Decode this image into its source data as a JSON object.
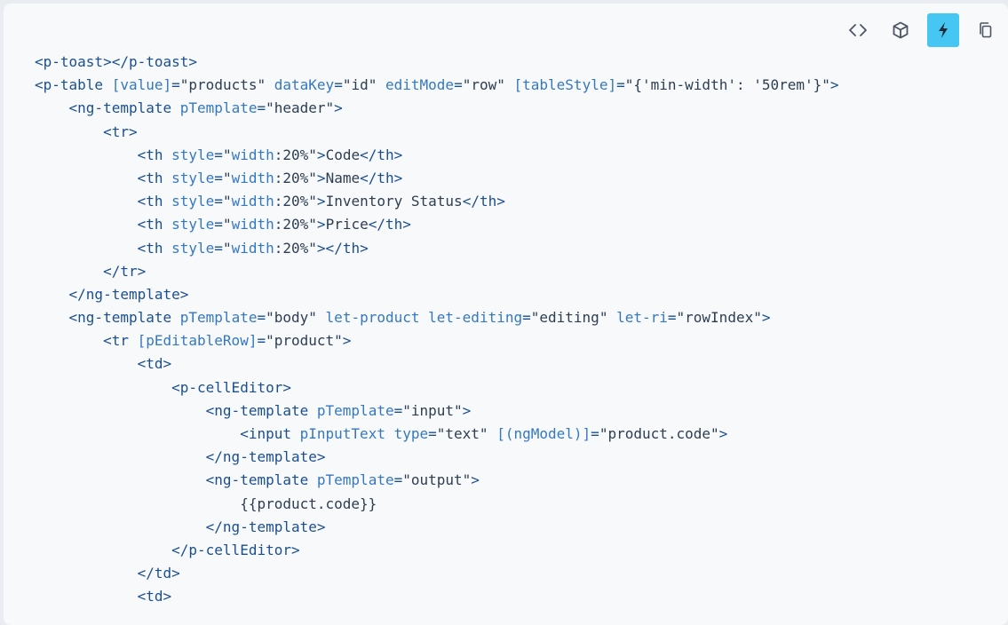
{
  "toolbar": {
    "buttons": [
      {
        "name": "code-toggle-button",
        "icon": "code-brackets-icon",
        "active": false
      },
      {
        "name": "stackblitz-box-button",
        "icon": "box-icon",
        "active": false
      },
      {
        "name": "stackblitz-button",
        "icon": "lightning-bolt-icon",
        "active": true
      },
      {
        "name": "copy-button",
        "icon": "copy-icon",
        "active": false
      }
    ],
    "active_color": "#45c6f3"
  },
  "code_lines": [
    {
      "indent": "",
      "parts": [
        [
          "tag",
          "<p-toast></p-toast>"
        ]
      ]
    },
    {
      "indent": "",
      "parts": [
        [
          "tag",
          "<p-table "
        ],
        [
          "attr",
          "[value]"
        ],
        [
          "tag",
          "="
        ],
        [
          "str",
          "\"products\" "
        ],
        [
          "attr",
          "dataKey"
        ],
        [
          "tag",
          "="
        ],
        [
          "str",
          "\"id\" "
        ],
        [
          "attr",
          "editMode"
        ],
        [
          "tag",
          "="
        ],
        [
          "str",
          "\"row\" "
        ],
        [
          "attr",
          "[tableStyle]"
        ],
        [
          "tag",
          "="
        ],
        [
          "str",
          "\"{'min-width': '50rem'}\""
        ],
        [
          "tag",
          ">"
        ]
      ]
    },
    {
      "indent": "    ",
      "parts": [
        [
          "tag",
          "<ng-template "
        ],
        [
          "attr",
          "pTemplate"
        ],
        [
          "tag",
          "="
        ],
        [
          "str",
          "\"header\""
        ],
        [
          "tag",
          ">"
        ]
      ]
    },
    {
      "indent": "        ",
      "parts": [
        [
          "tag",
          "<tr>"
        ]
      ]
    },
    {
      "indent": "            ",
      "parts": [
        [
          "tag",
          "<th "
        ],
        [
          "attr",
          "style"
        ],
        [
          "tag",
          "="
        ],
        [
          "str",
          "\""
        ],
        [
          "attr",
          "width"
        ],
        [
          "str",
          ":20%\""
        ],
        [
          "tag",
          ">"
        ],
        [
          "txt",
          "Code"
        ],
        [
          "tag",
          "</th>"
        ]
      ]
    },
    {
      "indent": "            ",
      "parts": [
        [
          "tag",
          "<th "
        ],
        [
          "attr",
          "style"
        ],
        [
          "tag",
          "="
        ],
        [
          "str",
          "\""
        ],
        [
          "attr",
          "width"
        ],
        [
          "str",
          ":20%\""
        ],
        [
          "tag",
          ">"
        ],
        [
          "txt",
          "Name"
        ],
        [
          "tag",
          "</th>"
        ]
      ]
    },
    {
      "indent": "            ",
      "parts": [
        [
          "tag",
          "<th "
        ],
        [
          "attr",
          "style"
        ],
        [
          "tag",
          "="
        ],
        [
          "str",
          "\""
        ],
        [
          "attr",
          "width"
        ],
        [
          "str",
          ":20%\""
        ],
        [
          "tag",
          ">"
        ],
        [
          "txt",
          "Inventory Status"
        ],
        [
          "tag",
          "</th>"
        ]
      ]
    },
    {
      "indent": "            ",
      "parts": [
        [
          "tag",
          "<th "
        ],
        [
          "attr",
          "style"
        ],
        [
          "tag",
          "="
        ],
        [
          "str",
          "\""
        ],
        [
          "attr",
          "width"
        ],
        [
          "str",
          ":20%\""
        ],
        [
          "tag",
          ">"
        ],
        [
          "txt",
          "Price"
        ],
        [
          "tag",
          "</th>"
        ]
      ]
    },
    {
      "indent": "            ",
      "parts": [
        [
          "tag",
          "<th "
        ],
        [
          "attr",
          "style"
        ],
        [
          "tag",
          "="
        ],
        [
          "str",
          "\""
        ],
        [
          "attr",
          "width"
        ],
        [
          "str",
          ":20%\""
        ],
        [
          "tag",
          "></th>"
        ]
      ]
    },
    {
      "indent": "        ",
      "parts": [
        [
          "tag",
          "</tr>"
        ]
      ]
    },
    {
      "indent": "    ",
      "parts": [
        [
          "tag",
          "</ng-template>"
        ]
      ]
    },
    {
      "indent": "    ",
      "parts": [
        [
          "tag",
          "<ng-template "
        ],
        [
          "attr",
          "pTemplate"
        ],
        [
          "tag",
          "="
        ],
        [
          "str",
          "\"body\" "
        ],
        [
          "attr",
          "let-product let-editing"
        ],
        [
          "tag",
          "="
        ],
        [
          "str",
          "\"editing\" "
        ],
        [
          "attr",
          "let-ri"
        ],
        [
          "tag",
          "="
        ],
        [
          "str",
          "\"rowIndex\""
        ],
        [
          "tag",
          ">"
        ]
      ]
    },
    {
      "indent": "        ",
      "parts": [
        [
          "tag",
          "<tr "
        ],
        [
          "attr",
          "[pEditableRow]"
        ],
        [
          "tag",
          "="
        ],
        [
          "str",
          "\"product\""
        ],
        [
          "tag",
          ">"
        ]
      ]
    },
    {
      "indent": "            ",
      "parts": [
        [
          "tag",
          "<td>"
        ]
      ]
    },
    {
      "indent": "                ",
      "parts": [
        [
          "tag",
          "<p-cellEditor>"
        ]
      ]
    },
    {
      "indent": "                    ",
      "parts": [
        [
          "tag",
          "<ng-template "
        ],
        [
          "attr",
          "pTemplate"
        ],
        [
          "tag",
          "="
        ],
        [
          "str",
          "\"input\""
        ],
        [
          "tag",
          ">"
        ]
      ]
    },
    {
      "indent": "                        ",
      "parts": [
        [
          "tag",
          "<input "
        ],
        [
          "attr",
          "pInputText type"
        ],
        [
          "tag",
          "="
        ],
        [
          "str",
          "\"text\" "
        ],
        [
          "attr",
          "[(ngModel)]"
        ],
        [
          "tag",
          "="
        ],
        [
          "str",
          "\"product.code\""
        ],
        [
          "tag",
          ">"
        ]
      ]
    },
    {
      "indent": "                    ",
      "parts": [
        [
          "tag",
          "</ng-template>"
        ]
      ]
    },
    {
      "indent": "                    ",
      "parts": [
        [
          "tag",
          "<ng-template "
        ],
        [
          "attr",
          "pTemplate"
        ],
        [
          "tag",
          "="
        ],
        [
          "str",
          "\"output\""
        ],
        [
          "tag",
          ">"
        ]
      ]
    },
    {
      "indent": "                        ",
      "parts": [
        [
          "txt",
          "{{product.code}}"
        ]
      ]
    },
    {
      "indent": "                    ",
      "parts": [
        [
          "tag",
          "</ng-template>"
        ]
      ]
    },
    {
      "indent": "                ",
      "parts": [
        [
          "tag",
          "</p-cellEditor>"
        ]
      ]
    },
    {
      "indent": "            ",
      "parts": [
        [
          "tag",
          "</td>"
        ]
      ]
    },
    {
      "indent": "            ",
      "parts": [
        [
          "tag",
          "<td>"
        ]
      ]
    }
  ]
}
